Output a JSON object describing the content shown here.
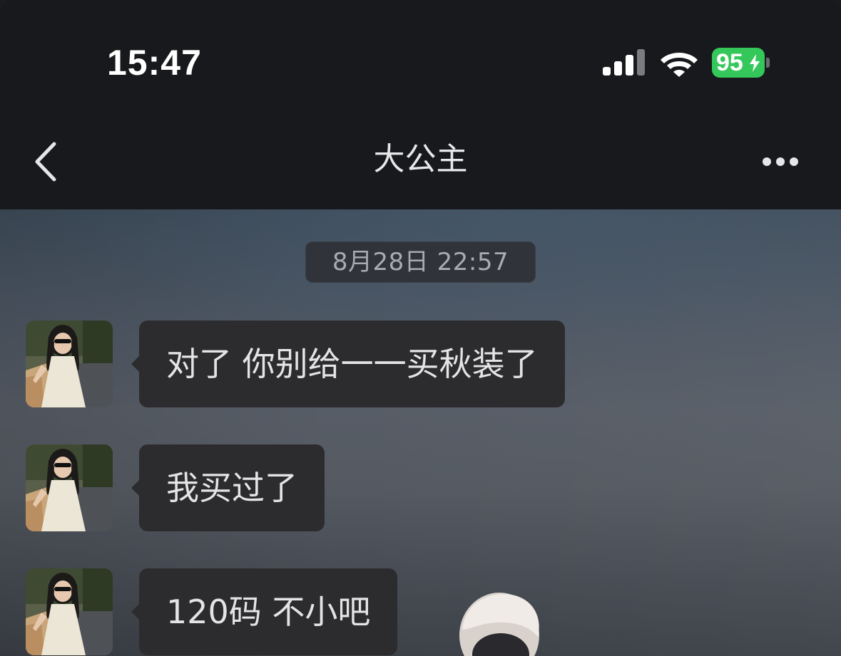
{
  "status_bar": {
    "time": "15:47",
    "signal_icon": "cellular-signal-icon",
    "wifi_icon": "wifi-icon",
    "battery_level": "95",
    "battery_icon": "battery-charging-icon",
    "battery_color": "#34c759"
  },
  "nav": {
    "back_icon": "chevron-left-icon",
    "title": "大公主",
    "more_icon": "more-dots-icon"
  },
  "chat": {
    "timestamp": "8月28日 22:57",
    "bubble_color": "#2c2c2e",
    "messages": [
      {
        "sender": "other",
        "avatar": "contact-avatar",
        "text": "对了 你别给一一买秋装了"
      },
      {
        "sender": "other",
        "avatar": "contact-avatar",
        "text": "我买过了"
      },
      {
        "sender": "other",
        "avatar": "contact-avatar",
        "text": "120码 不小吧"
      }
    ]
  }
}
